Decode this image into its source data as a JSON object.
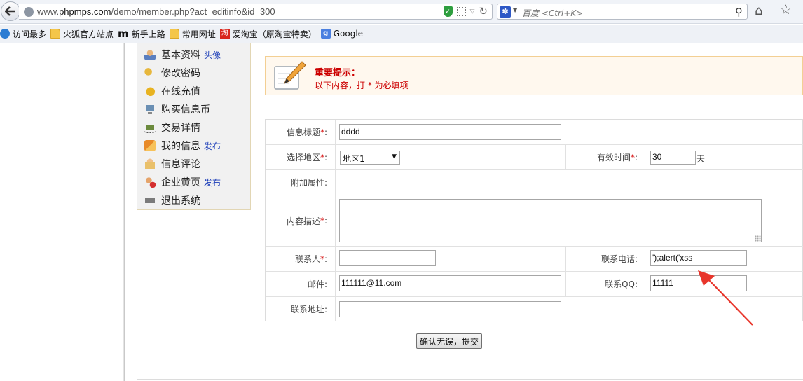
{
  "browser": {
    "url_prefix": "www.",
    "url_domain": "phpmps.com",
    "url_path": "/demo/member.php?act=editinfo&id=300",
    "search_placeholder": "百度 <Ctrl+K>",
    "bookmarks": [
      {
        "label": "访问最多",
        "icon": "gear-icon"
      },
      {
        "label": "火狐官方站点",
        "icon": "folder-icon"
      },
      {
        "label": "新手上路",
        "icon": "m-icon"
      },
      {
        "label": "常用网址",
        "icon": "folder-icon"
      },
      {
        "label": "爱淘宝（原淘宝特卖）",
        "icon": "taobao-icon"
      },
      {
        "label": "Google",
        "icon": "google-icon"
      }
    ]
  },
  "sidebar": {
    "items": [
      {
        "label": "基本资料",
        "link": "头像",
        "icon": "user-icon"
      },
      {
        "label": "修改密码",
        "link": "",
        "icon": "key-icon"
      },
      {
        "label": "在线充值",
        "link": "",
        "icon": "coin-icon"
      },
      {
        "label": "购买信息币",
        "link": "",
        "icon": "monitor-icon"
      },
      {
        "label": "交易详情",
        "link": "",
        "icon": "cart-icon"
      },
      {
        "label": "我的信息",
        "link": "发布",
        "icon": "flag-icon"
      },
      {
        "label": "信息评论",
        "link": "",
        "icon": "comment-icon"
      },
      {
        "label": "企业黄页",
        "link": "发布",
        "icon": "company-icon"
      },
      {
        "label": "退出系统",
        "link": "",
        "icon": "exit-icon"
      }
    ]
  },
  "notice": {
    "title": "重要提示：",
    "body_prefix": "以下内容，打 ",
    "body_star": "*",
    "body_suffix": " 为必填项"
  },
  "form": {
    "req_mark": "*",
    "colon": ":",
    "title_label": "信息标题",
    "title_value": "dddd",
    "region_label": "选择地区",
    "region_value": "地区1",
    "valid_label": "有效时间",
    "valid_value": "30",
    "valid_unit": "天",
    "extra_label": "附加属性:",
    "content_label": "内容描述",
    "content_value": "",
    "contact_label": "联系人",
    "contact_value": "",
    "phone_label": "联系电话:",
    "phone_value": "');alert('xss",
    "email_label": "邮件:",
    "email_value": "111111@11.com",
    "qq_label": "联系QQ:",
    "qq_value": "11111",
    "address_label": "联系地址:",
    "address_value": "",
    "submit_label": "确认无误，提交"
  },
  "colors": {
    "required": "#d40000",
    "notice_bg": "#fff8ee",
    "annotation_arrow": "#e8352b"
  }
}
